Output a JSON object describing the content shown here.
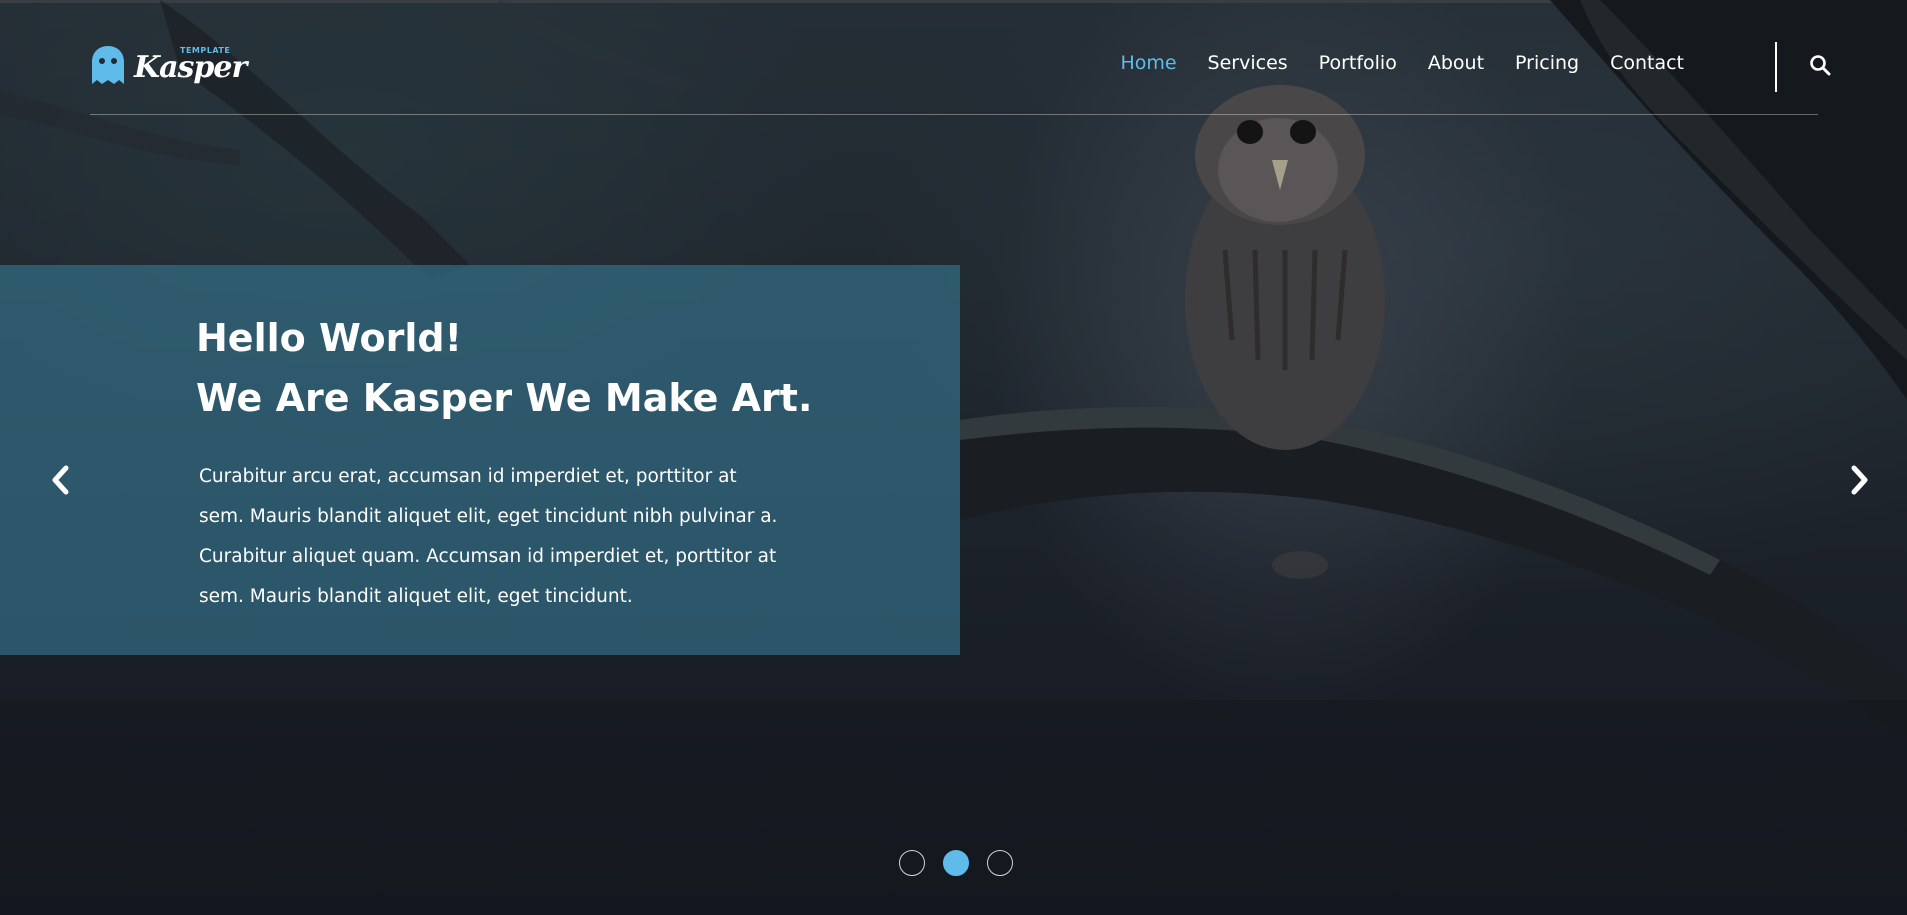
{
  "brand": {
    "name": "Kasper",
    "tag": "TEMPLATE",
    "accent": "#5fbcea"
  },
  "nav": {
    "items": [
      {
        "label": "Home",
        "active": true
      },
      {
        "label": "Services",
        "active": false
      },
      {
        "label": "Portfolio",
        "active": false
      },
      {
        "label": "About",
        "active": false
      },
      {
        "label": "Pricing",
        "active": false
      },
      {
        "label": "Contact",
        "active": false
      }
    ],
    "search_icon": "search-icon"
  },
  "slide": {
    "heading_line1": "Hello World!",
    "heading_line2": "We Are Kasper We Make Art.",
    "body": "Curabitur arcu erat, accumsan id imperdiet et, porttitor at sem. Mauris blandit aliquet elit, eget tincidunt nibh pulvinar a. Curabitur aliquet quam. Accumsan id imperdiet et, porttitor at sem. Mauris blandit aliquet elit, eget tincidunt.",
    "panel_color": "#377891",
    "prev_icon": "chevron-left-icon",
    "next_icon": "chevron-right-icon"
  },
  "slider": {
    "count": 3,
    "active_index": 1
  }
}
